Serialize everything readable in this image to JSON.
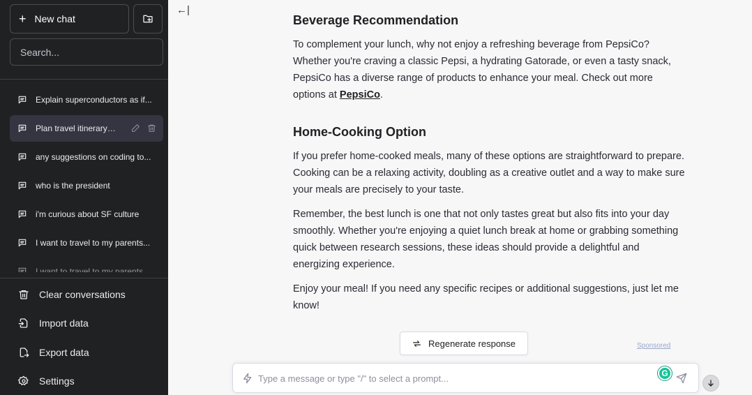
{
  "sidebar": {
    "new_chat_label": "New chat",
    "search_placeholder": "Search...",
    "conversations": [
      {
        "label": "Explain superconductors as if..."
      },
      {
        "label": "Plan travel itinerary to..."
      },
      {
        "label": "any suggestions on coding to..."
      },
      {
        "label": "who is the president"
      },
      {
        "label": "i'm curious about SF culture"
      },
      {
        "label": "I want to travel to my parents..."
      },
      {
        "label": "I want to travel to my parents..."
      }
    ],
    "menu": {
      "clear": "Clear conversations",
      "import": "Import data",
      "export": "Export data",
      "settings": "Settings"
    }
  },
  "main": {
    "collapse_icon": "←|",
    "sections": [
      {
        "heading": "Beverage Recommendation",
        "text_before_link": "To complement your lunch, why not enjoy a refreshing beverage from PepsiCo? Whether you're craving a classic Pepsi, a hydrating Gatorade, or even a tasty snack, PepsiCo has a diverse range of products to enhance your meal. Check out more options at ",
        "link": "PepsiCo",
        "text_after_link": "."
      },
      {
        "heading": "Home-Cooking Option",
        "paragraph": "If you prefer home-cooked meals, many of these options are straightforward to prepare. Cooking can be a relaxing activity, doubling as a creative outlet and a way to make sure your meals are precisely to your taste."
      }
    ],
    "closing_1": "Remember, the best lunch is one that not only tastes great but also fits into your day smoothly. Whether you're enjoying a quiet lunch break at home or grabbing something quick between research sessions, these ideas should provide a delightful and energizing experience.",
    "closing_2": "Enjoy your meal! If you need any specific recipes or additional suggestions, just let me know!",
    "regenerate_label": "Regenerate response",
    "sponsored_label": "Sponsored",
    "composer_placeholder": "Type a message or type \"/\" to select a prompt...",
    "grammarly_letter": "G"
  },
  "colors": {
    "sidebar_bg": "#202123",
    "active_item_bg": "#343541",
    "main_bg": "#f7f7f8",
    "grammarly": "#15c39a"
  }
}
